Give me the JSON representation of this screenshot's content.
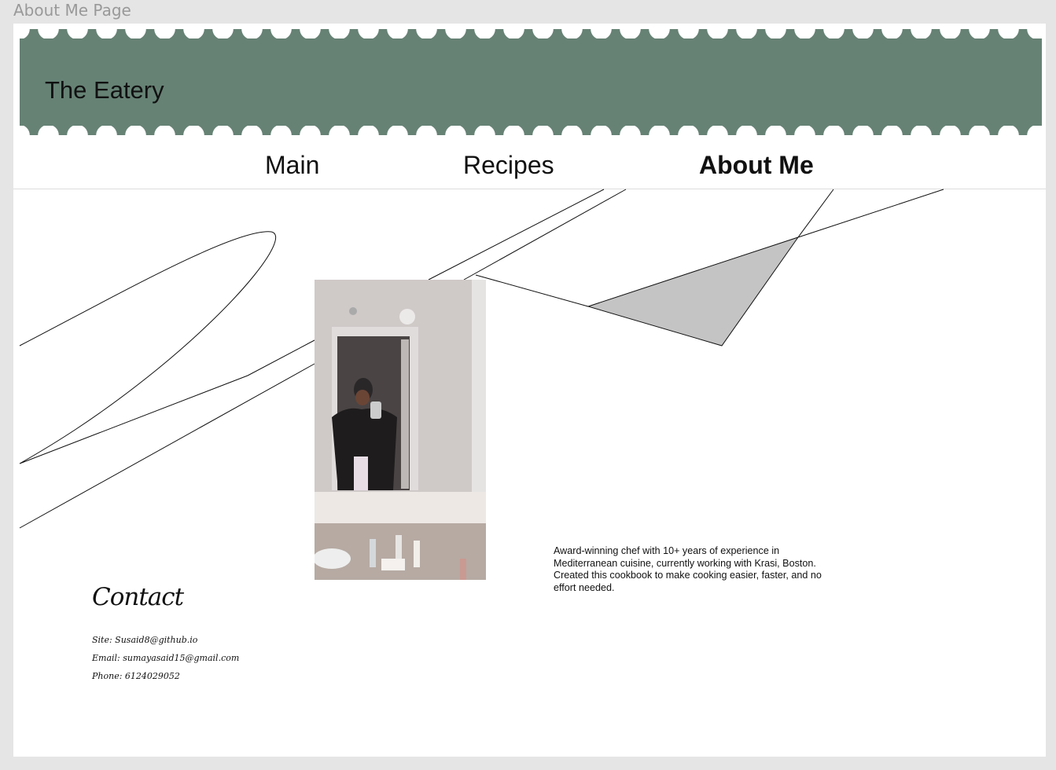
{
  "frame_title": "About Me Page",
  "header": {
    "title": "The Eatery",
    "color": "#668275"
  },
  "nav": {
    "items": [
      {
        "label": "Main"
      },
      {
        "label": "Recipes"
      },
      {
        "label": "About Me",
        "active": true
      }
    ]
  },
  "bio": "Award-winning chef with 10+ years of experience in Mediterranean cuisine, currently working with Krasi, Boston. Created this cookbook to make cooking easier, faster, and no effort needed.",
  "contact": {
    "heading": "Contact",
    "site": "Site: Susaid8@github.io",
    "email": "Email: sumayasaid15@gmail.com",
    "phone": "Phone: 6124029052"
  },
  "photo": {
    "icon": "mirror-selfie-photo"
  }
}
